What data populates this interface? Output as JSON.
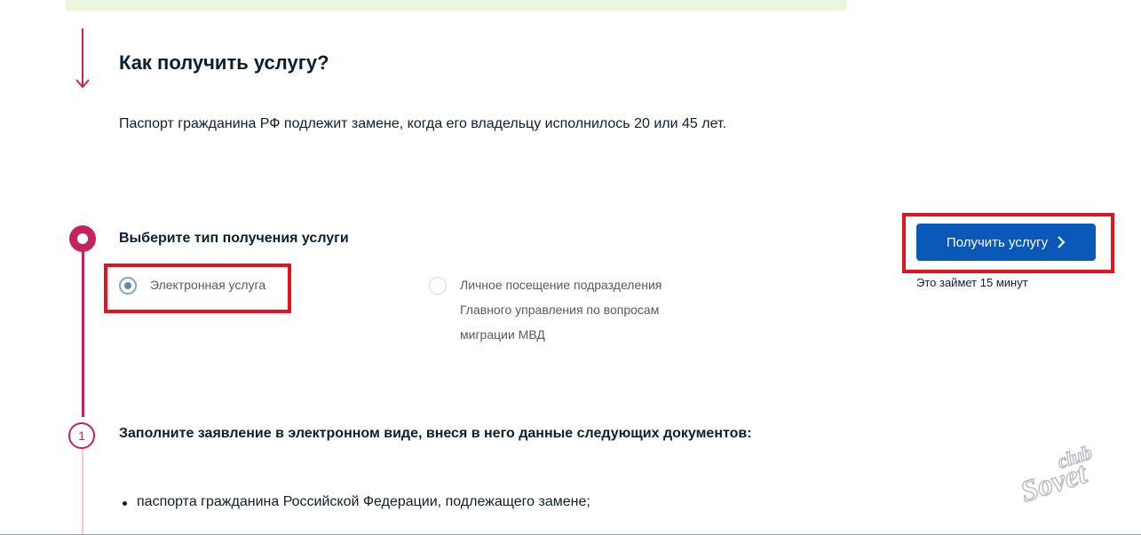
{
  "how_to": {
    "title": "Как получить услугу?",
    "description": "Паспорт гражданина РФ подлежит замене, когда его владельцу исполнилось 20 или 45 лет."
  },
  "service_type": {
    "title": "Выберите тип получения услуги",
    "options": [
      {
        "label": "Электронная услуга",
        "selected": true
      },
      {
        "label": "Личное посещение подразделения Главного управления по вопросам миграции МВД",
        "selected": false
      }
    ]
  },
  "action": {
    "button_label": "Получить услугу",
    "time_note": "Это займет 15 минут",
    "button_color": "#0a58b8"
  },
  "step1": {
    "number": "1",
    "title": "Заполните заявление в электронном виде, внеся в него данные следующих документов:",
    "documents": [
      "паспорта гражданина Российской Федерации, подлежащего замене;"
    ]
  },
  "watermark": {
    "text_top": "club",
    "text_bottom": "Sovet"
  },
  "colors": {
    "accent": "#c5235c",
    "highlight": "#e0141e",
    "banner": "#ecf6de"
  }
}
